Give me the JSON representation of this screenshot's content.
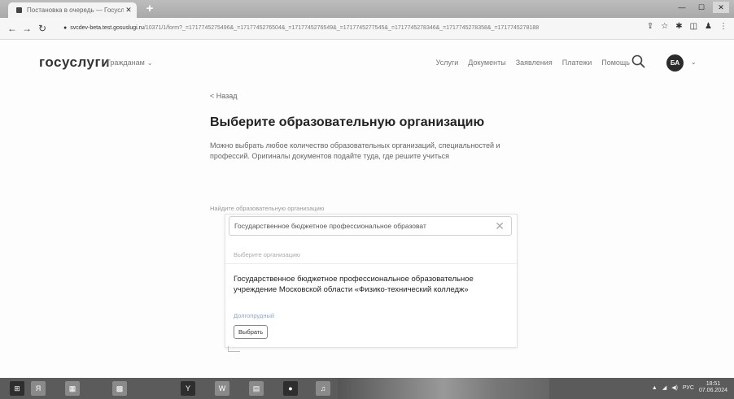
{
  "browser": {
    "tab_title": "Постановка в очередь — Госуслуги",
    "url_host": "svcdev-beta.test.gosuslugi.ru",
    "url_path": "/10371/1/form?_=1717745275496&_=1717745276504&_=1717745276549&_=1717745277545&_=1717745278346&_=1717745278358&_=1717745278188"
  },
  "header": {
    "logo": "госуслуги",
    "role": "Гражданам",
    "menu": [
      "Услуги",
      "Документы",
      "Заявления",
      "Платежи",
      "Помощь"
    ],
    "avatar_initials": "БА"
  },
  "main": {
    "back_label": "< Назад",
    "title": "Выберите образовательную организацию",
    "description": "Можно выбрать любое количество образовательных организаций, специальностей и профессий. Оригиналы документов подайте туда, где решите учиться",
    "field_label": "Найдите образовательную организацию",
    "search_value": "Государственное бюджетное профессиональное образоват",
    "suggest_label": "Выберите организацию",
    "result": {
      "name": "Государственное бюджетное профессиональное образовательное учреждение Московской области «Физико-технический колледж»",
      "link": "Долгопрудный",
      "button": "Выбрать"
    }
  },
  "taskbar": {
    "items": [
      "Я",
      "▦",
      "▩",
      "Y",
      "W",
      "▤",
      "●",
      "♫"
    ],
    "lang": "РУС",
    "time": "18:51",
    "date": "07.06.2024"
  },
  "colors": {
    "accent": "#2b2b2b",
    "link": "#8aa7d6"
  }
}
